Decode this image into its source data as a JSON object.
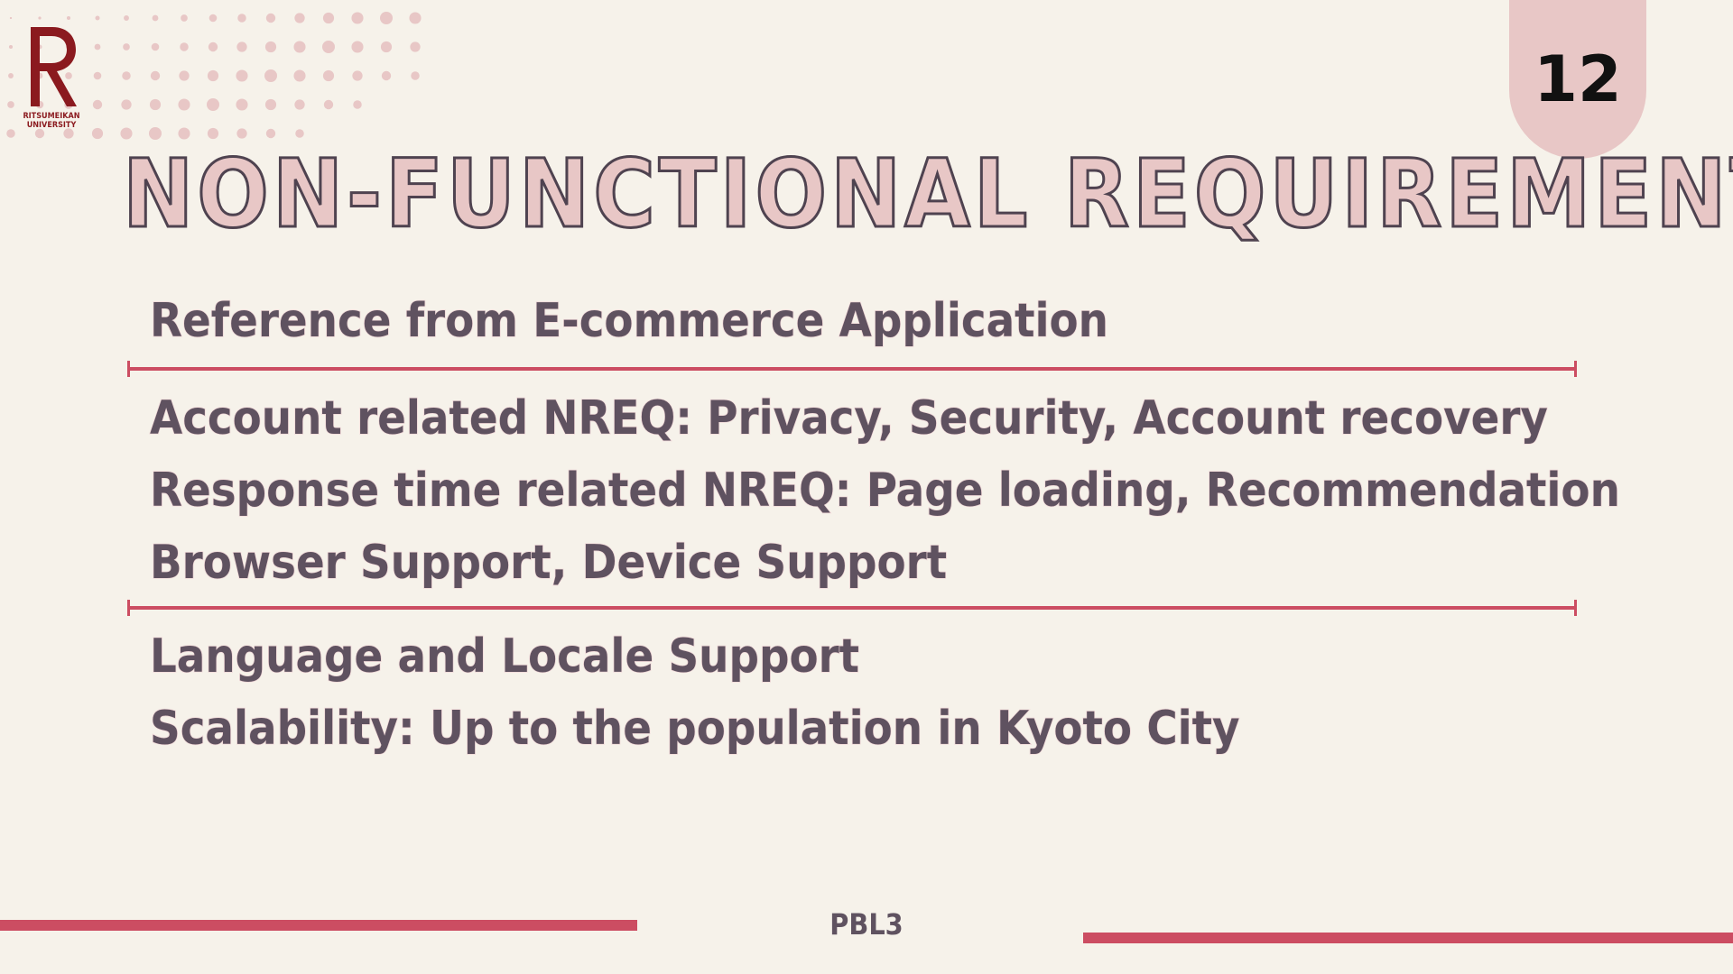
{
  "logo": {
    "name_line1": "RITSUMEIKAN",
    "name_line2": "UNIVERSITY"
  },
  "page_number": "12",
  "title": "NON-FUNCTIONAL REQUIREMENT",
  "reference": "Reference from  E-commerce Application",
  "group1": [
    "Account related NREQ: Privacy, Security, Account recovery",
    "Response time related NREQ: Page loading, Recommendation",
    "Browser Support, Device Support"
  ],
  "group2": [
    "Language and Locale Support",
    "Scalability: Up to the population in Kyoto City"
  ],
  "footer": {
    "label": "PBL3"
  },
  "colors": {
    "background": "#f6f2ea",
    "accent_red": "#cc4d62",
    "pink": "#e8c7c6",
    "text": "#5f5260",
    "logo_red": "#8b1a1f"
  }
}
